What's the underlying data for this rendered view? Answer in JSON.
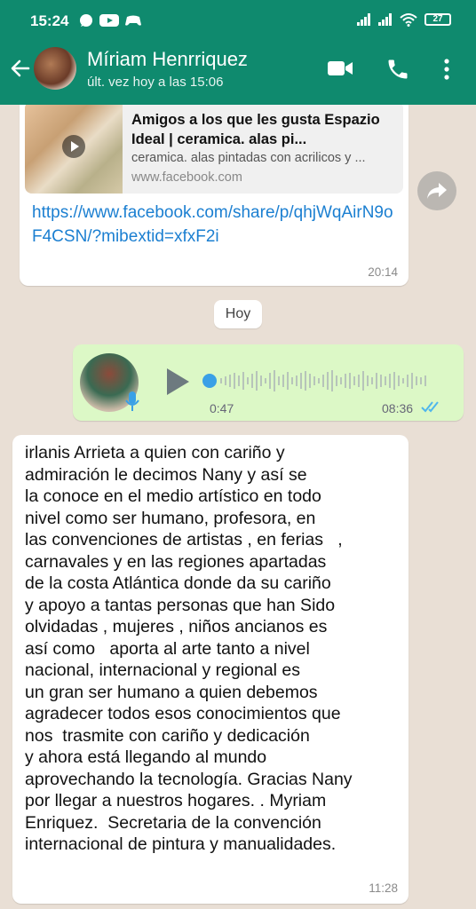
{
  "status_bar": {
    "time": "15:24",
    "battery": "27"
  },
  "contact": {
    "name": "Míriam Henrriquez",
    "last_seen": "últ. vez hoy a las 15:06"
  },
  "link_message": {
    "preview_title": "Amigos a los que les gusta Espazio Ideal | ceramica. alas pi...",
    "preview_description": "ceramica. alas pintadas con acrilicos y ...",
    "preview_domain": "www.facebook.com",
    "url": "https://www.facebook.com/share/p/qhjWqAirN9oF4CSN/?mibextid=xfxF2i",
    "time": "20:14"
  },
  "day_divider": "Hoy",
  "voice_message": {
    "duration": "0:47",
    "time": "08:36",
    "status": "read",
    "progress": 0.0
  },
  "text_message": {
    "lines": [
      "irlanis Arrieta a quien con cariño y",
      "admiración le decimos Nany y así se",
      "la conoce en el medio artístico en todo",
      "nivel como ser humano, profesora, en",
      "las convenciones de artistas , en ferias   ,",
      "carnavales y en las regiones apartadas",
      "de la costa Atlántica donde da su cariño",
      "y apoyo a tantas personas que han Sido",
      "olvidadas , mujeres , niños ancianos es",
      "así como   aporta al arte tanto a nivel",
      "nacional, internacional y regional es",
      "un gran ser humano a quien debemos",
      "agradecer todos esos conocimientos que",
      "nos  trasmite con cariño y dedicación",
      "y ahora está llegando al mundo",
      "aprovechando la tecnología. Gracias Nany",
      "por llegar a nuestros hogares. . Myriam",
      "Enriquez.  Secretaria de la convención",
      "internacional de pintura y manualidades."
    ],
    "time": "11:28"
  },
  "colors": {
    "header": "#0f8a6e",
    "background": "#e9dfd5",
    "outgoing_bubble": "#dcf8c6",
    "link": "#1b7fd1",
    "read_ticks": "#4fb6ec"
  }
}
